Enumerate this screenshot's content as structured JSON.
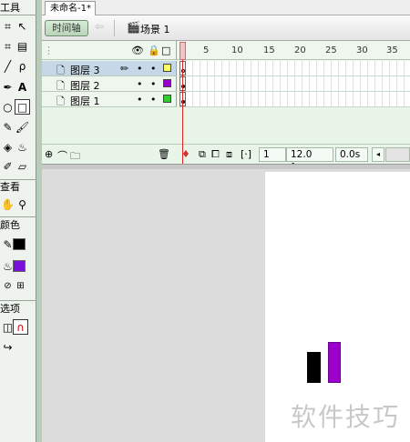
{
  "tools_panel": {
    "title": "工具",
    "view_section": "查看",
    "colors_section": "颜色",
    "options_section": "选项"
  },
  "document": {
    "tab_label": "未命名-1*"
  },
  "toolbar": {
    "timeline_button": "时间轴",
    "scene_label": "场景 1"
  },
  "timeline": {
    "frame_numbers": [
      "5",
      "10",
      "15",
      "20",
      "25",
      "30",
      "35"
    ],
    "layers": [
      {
        "name": "图层 3",
        "color": "#ffff66",
        "active": true
      },
      {
        "name": "图层 2",
        "color": "#9900cc",
        "active": false
      },
      {
        "name": "图层 1",
        "color": "#33cc33",
        "active": false
      }
    ],
    "current_frame": "1",
    "frame_rate": "12.0 fps",
    "elapsed_time": "0.0s"
  },
  "stage": {
    "watermark": "软件技巧",
    "shape_colors": [
      "#000000",
      "#9b00cc"
    ]
  }
}
